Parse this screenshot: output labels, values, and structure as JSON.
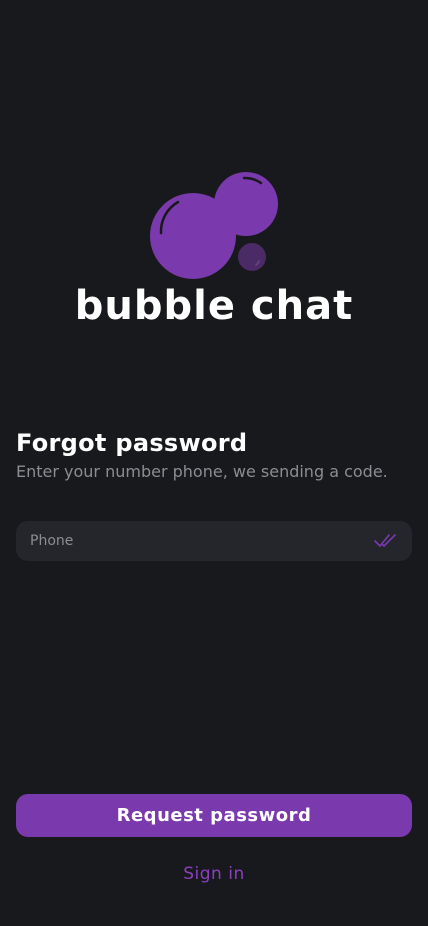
{
  "brand": {
    "name": "bubble chat",
    "logo_icon": "bubbles-logo-icon"
  },
  "form": {
    "title": "Forgot password",
    "subtitle": "Enter your number phone, we sending a code.",
    "phone": {
      "value": "",
      "placeholder": "Phone",
      "status_icon": "double-check-icon"
    },
    "submit_label": "Request password",
    "sign_in_label": "Sign in"
  },
  "colors": {
    "background": "#18191c",
    "accent": "#7a39ad",
    "accent_text": "#8c3fc4",
    "input_background": "#24262b",
    "muted_text": "#8b8d92"
  }
}
